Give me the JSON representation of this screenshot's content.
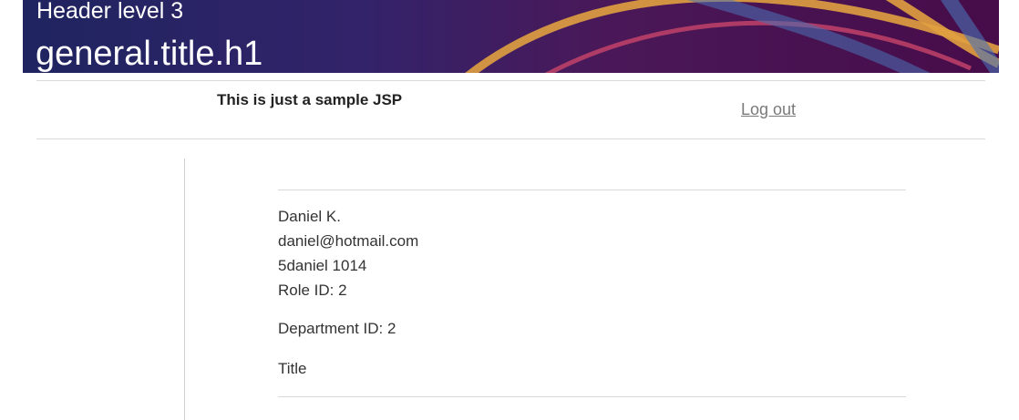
{
  "header": {
    "subheading": "Header level 3",
    "title": "general.title.h1"
  },
  "nav": {
    "subtitle": "This is just a sample JSP",
    "logout_label": "Log out"
  },
  "user": {
    "name": "Daniel K.",
    "email": "daniel@hotmail.com",
    "username_line": "5daniel 1014",
    "role_line": "Role ID: 2",
    "department_line": "Department ID: 2",
    "title_line": "Title"
  },
  "colors": {
    "banner_start": "#1f2460",
    "banner_end": "#470c4a",
    "ribbon_orange": "#e0a040",
    "ribbon_blue": "#4a73b8",
    "link": "#7a7a7a"
  }
}
